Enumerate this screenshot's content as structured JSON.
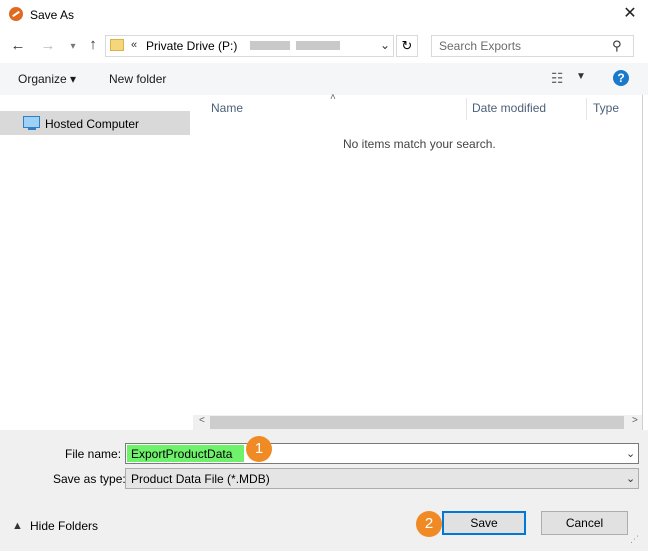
{
  "window": {
    "title": "Save As"
  },
  "address": {
    "chevron": "«",
    "path": "Private Drive (P:)"
  },
  "search": {
    "placeholder": "Search Exports"
  },
  "toolbar": {
    "organize_label": "Organize ▾",
    "new_folder_label": "New folder"
  },
  "nav_pane": {
    "items": [
      {
        "label": "Hosted Computer",
        "icon": "computer-icon",
        "selected": true
      }
    ]
  },
  "file_list": {
    "columns": [
      "Name",
      "Date modified",
      "Type"
    ],
    "empty_message": "No items match your search."
  },
  "form": {
    "file_name_label": "File name:",
    "file_name_value": "ExportProductData",
    "save_type_label": "Save as type:",
    "save_type_value": "Product Data File (*.MDB)"
  },
  "annotations": {
    "badge_1": "1",
    "badge_2": "2"
  },
  "footer": {
    "hide_folders_label": "Hide Folders",
    "save_label": "Save",
    "cancel_label": "Cancel"
  },
  "colors": {
    "highlight": "#6ef26b",
    "badge": "#f08a24",
    "help": "#1979ca",
    "accent": "#0078d7"
  }
}
